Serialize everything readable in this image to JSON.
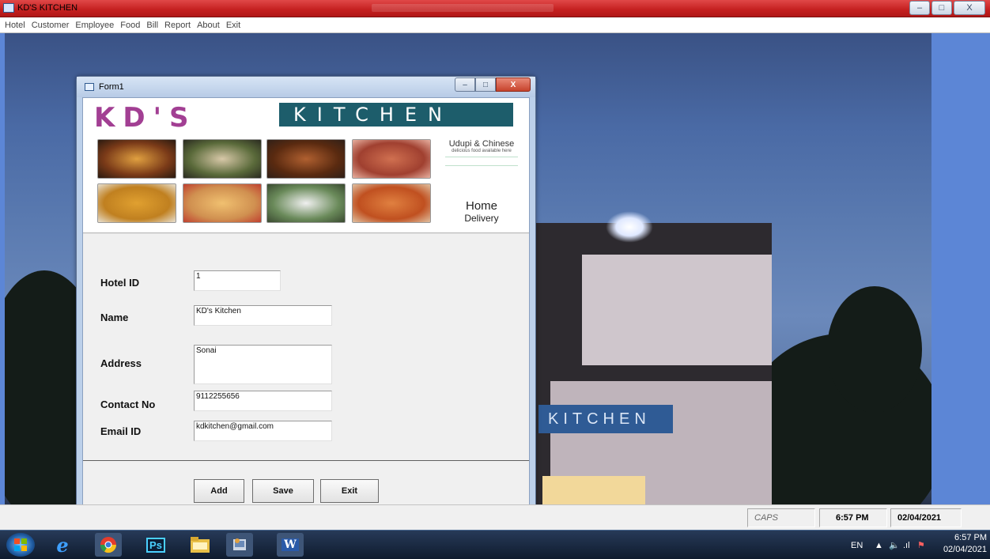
{
  "window": {
    "title": "KD'S KITCHEN",
    "buttons": {
      "minimize": "–",
      "maximize": "□",
      "close": "X"
    }
  },
  "menu": [
    "Hotel",
    "Customer",
    "Employee",
    "Food",
    "Bill",
    "Report",
    "About",
    "Exit"
  ],
  "background": {
    "sign_text": "KITCHEN"
  },
  "form": {
    "title": "Form1",
    "banner": {
      "logo_left": "KD'S",
      "logo_right": "KITCHEN",
      "tagline": "Udupi & Chinese",
      "tagline_sub": "delicious food available here",
      "home": "Home",
      "delivery": "Delivery"
    },
    "fields": {
      "hotel_id": {
        "label": "Hotel ID",
        "value": "1"
      },
      "name": {
        "label": "Name",
        "value": "KD's Kitchen"
      },
      "address": {
        "label": "Address",
        "value": "Sonai"
      },
      "contact": {
        "label": "Contact No",
        "value": "9112255656"
      },
      "email": {
        "label": "Email ID",
        "value": "kdkitchen@gmail.com"
      }
    },
    "buttons": {
      "add": "Add",
      "save": "Save",
      "exit": "Exit"
    }
  },
  "statusbar": {
    "caps": "CAPS",
    "time": "6:57 PM",
    "date": "02/04/2021"
  },
  "taskbar": {
    "lang": "EN",
    "time": "6:57 PM",
    "date": "02/04/2021",
    "ps_label": "Ps",
    "word_label": "W"
  },
  "colors": {
    "titlebar": "#c41f1f",
    "logo_purple": "#a23f93",
    "logo_teal": "#1d5d6b",
    "desktop_blue": "#5c86d6"
  }
}
